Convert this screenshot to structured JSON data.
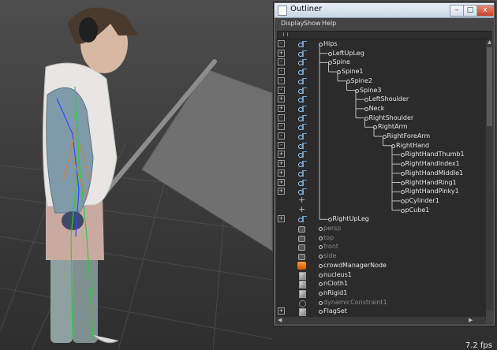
{
  "viewport": {
    "fps": "7.2 fps"
  },
  "outliner": {
    "title": "Outliner",
    "window_buttons": {
      "minimize": "–",
      "maximize": "□",
      "close": "x"
    },
    "menus": [
      "Display",
      "Show",
      "Help"
    ],
    "rows": [
      {
        "label": "Hips",
        "depth": 0,
        "expander": "-",
        "icon": "joint-icon",
        "dim": false
      },
      {
        "label": "LeftUpLeg",
        "depth": 1,
        "expander": "+",
        "icon": "joint-icon",
        "dim": false
      },
      {
        "label": "Spine",
        "depth": 1,
        "expander": "-",
        "icon": "joint-icon",
        "dim": false
      },
      {
        "label": "Spine1",
        "depth": 2,
        "expander": "-",
        "icon": "joint-icon",
        "dim": false
      },
      {
        "label": "Spine2",
        "depth": 3,
        "expander": "-",
        "icon": "joint-icon",
        "dim": false
      },
      {
        "label": "Spine3",
        "depth": 4,
        "expander": "-",
        "icon": "joint-icon",
        "dim": false
      },
      {
        "label": "LeftShoulder",
        "depth": 5,
        "expander": "+",
        "icon": "joint-icon",
        "dim": false
      },
      {
        "label": "Neck",
        "depth": 5,
        "expander": "+",
        "icon": "joint-icon",
        "dim": false
      },
      {
        "label": "RightShoulder",
        "depth": 5,
        "expander": "-",
        "icon": "joint-icon",
        "dim": false
      },
      {
        "label": "RightArm",
        "depth": 6,
        "expander": "-",
        "icon": "joint-icon",
        "dim": false
      },
      {
        "label": "RightForeArm",
        "depth": 7,
        "expander": "-",
        "icon": "joint-icon",
        "dim": false
      },
      {
        "label": "RightHand",
        "depth": 8,
        "expander": "-",
        "icon": "joint-icon",
        "dim": false
      },
      {
        "label": "RightHandThumb1",
        "depth": 9,
        "expander": "+",
        "icon": "joint-icon",
        "dim": false
      },
      {
        "label": "RightHandIndex1",
        "depth": 9,
        "expander": "+",
        "icon": "joint-icon",
        "dim": false
      },
      {
        "label": "RightHandMiddle1",
        "depth": 9,
        "expander": "+",
        "icon": "joint-icon",
        "dim": false
      },
      {
        "label": "RightHandRing1",
        "depth": 9,
        "expander": "+",
        "icon": "joint-icon",
        "dim": false
      },
      {
        "label": "RightHandPinky1",
        "depth": 9,
        "expander": "+",
        "icon": "joint-icon",
        "dim": false
      },
      {
        "label": "pCylinder1",
        "depth": 9,
        "expander": "",
        "icon": "loc-icon",
        "dim": false
      },
      {
        "label": "pCube1",
        "depth": 9,
        "expander": "",
        "icon": "loc-icon",
        "dim": false
      },
      {
        "label": "RightUpLeg",
        "depth": 1,
        "expander": "+",
        "icon": "joint-icon",
        "dim": false
      },
      {
        "label": "persp",
        "depth": 0,
        "expander": "",
        "icon": "cam-icon",
        "dim": true
      },
      {
        "label": "top",
        "depth": 0,
        "expander": "",
        "icon": "cam-icon",
        "dim": true
      },
      {
        "label": "front",
        "depth": 0,
        "expander": "",
        "icon": "cam-icon",
        "dim": true
      },
      {
        "label": "side",
        "depth": 0,
        "expander": "",
        "icon": "cam-icon",
        "dim": true
      },
      {
        "label": "crowdManagerNode",
        "depth": 0,
        "expander": "",
        "icon": "node-icon",
        "dim": false
      },
      {
        "label": "nucleus1",
        "depth": 0,
        "expander": "",
        "icon": "shape-icon",
        "dim": false
      },
      {
        "label": "nCloth1",
        "depth": 0,
        "expander": "",
        "icon": "shape-icon",
        "dim": false
      },
      {
        "label": "nRigid1",
        "depth": 0,
        "expander": "",
        "icon": "shape-icon",
        "dim": false
      },
      {
        "label": "dynamicConstraint1",
        "depth": 0,
        "expander": "",
        "icon": "const-icon",
        "dim": true
      },
      {
        "label": "FlagSet",
        "depth": 0,
        "expander": "+",
        "icon": "shape-icon",
        "dim": false
      }
    ]
  }
}
